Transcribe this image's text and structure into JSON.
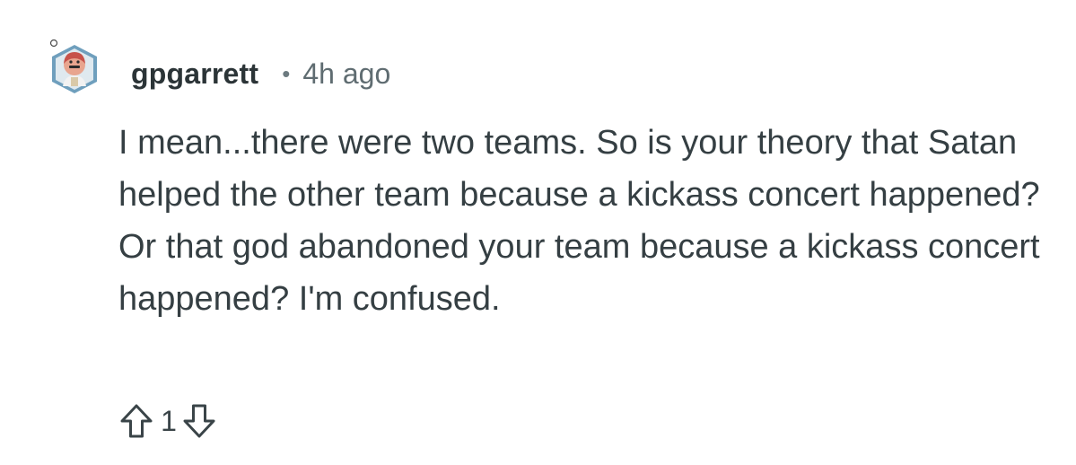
{
  "comment": {
    "username": "gpgarrett",
    "separator": "•",
    "timestamp": "4h ago",
    "text": "I mean...there were two teams. So is your theory that Satan helped the other team because a kickass concert happened? Or that god abandoned your team because a kickass concert happened? I'm confused.",
    "score": "1"
  },
  "icons": {
    "avatar": "user-avatar-icon",
    "upvote": "upvote-arrow-icon",
    "downvote": "downvote-arrow-icon"
  },
  "colors": {
    "text": "#353f43",
    "meta": "#5f6c71",
    "avatar_bg": "#6f9fbd"
  }
}
